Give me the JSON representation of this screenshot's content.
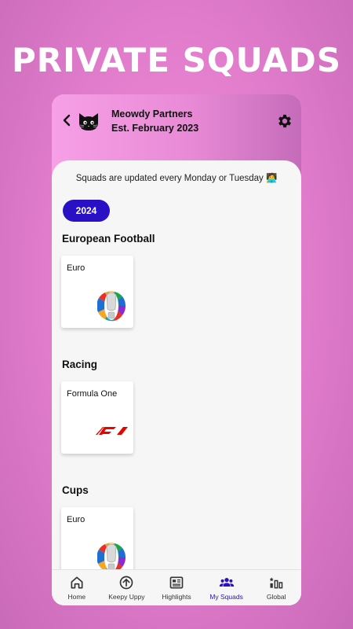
{
  "promo": {
    "title": "PRIVATE SQUADS"
  },
  "header": {
    "team_name": "Meowdy Partners",
    "established": "Est. February 2023"
  },
  "notice": "Squads are updated every Monday or Tuesday 🧑‍💻",
  "year": "2024",
  "sections": [
    {
      "title": "European Football",
      "card_label": "Euro",
      "logo": "euro-trophy-icon"
    },
    {
      "title": "Racing",
      "card_label": "Formula One",
      "logo": "f1-logo-icon"
    },
    {
      "title": "Cups",
      "card_label": "Euro",
      "logo": "euro-trophy-icon"
    }
  ],
  "tabs": [
    {
      "label": "Home",
      "icon": "home-icon"
    },
    {
      "label": "Keepy Uppy",
      "icon": "arrow-up-circle-icon"
    },
    {
      "label": "Highlights",
      "icon": "newspaper-icon"
    },
    {
      "label": "My Squads",
      "icon": "people-icon",
      "active": true
    },
    {
      "label": "Global",
      "icon": "leaderboard-icon"
    }
  ],
  "colors": {
    "accent": "#2a10c4",
    "header_pink": "#e98ad6",
    "background_pink": "#e47fce"
  }
}
